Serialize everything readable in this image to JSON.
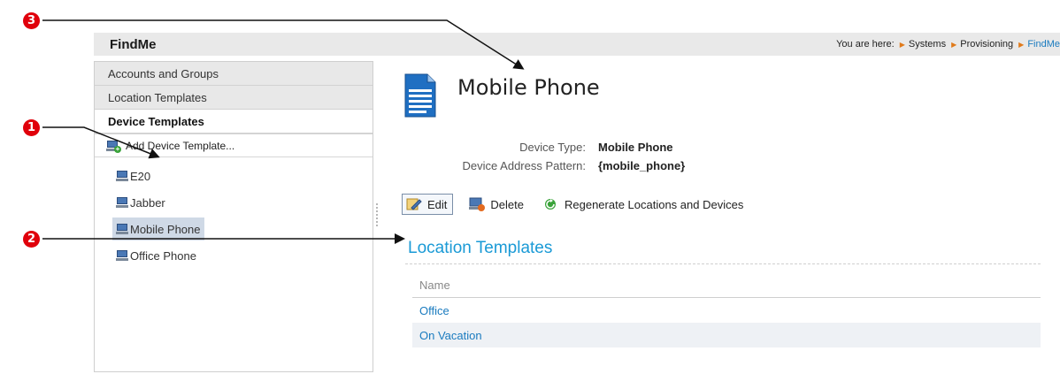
{
  "header": {
    "app_title": "FindMe",
    "breadcrumb_prefix": "You are here:",
    "breadcrumb": [
      "Systems",
      "Provisioning",
      "FindMe"
    ]
  },
  "sidebar": {
    "sections": [
      {
        "label": "Accounts and Groups"
      },
      {
        "label": "Location Templates"
      },
      {
        "label": "Device Templates"
      }
    ],
    "add_label": "Add Device Template...",
    "devices": [
      {
        "label": "E20",
        "selected": false
      },
      {
        "label": "Jabber",
        "selected": false
      },
      {
        "label": "Mobile Phone",
        "selected": true
      },
      {
        "label": "Office Phone",
        "selected": false
      }
    ]
  },
  "main": {
    "title": "Mobile Phone",
    "properties": {
      "device_type_label": "Device Type:",
      "device_type_value": "Mobile Phone",
      "pattern_label": "Device Address Pattern:",
      "pattern_value": "{mobile_phone}"
    },
    "toolbar": {
      "edit": "Edit",
      "delete": "Delete",
      "regenerate": "Regenerate Locations and Devices"
    },
    "location_templates": {
      "title": "Location Templates",
      "column": "Name",
      "rows": [
        "Office",
        "On Vacation"
      ]
    }
  },
  "callouts": {
    "one": "1",
    "two": "2",
    "three": "3"
  },
  "colors": {
    "accent_link": "#1a7bbf",
    "section_title": "#1a9ad6",
    "callout": "#e0000b",
    "selected_bg": "#cfd9e6"
  }
}
